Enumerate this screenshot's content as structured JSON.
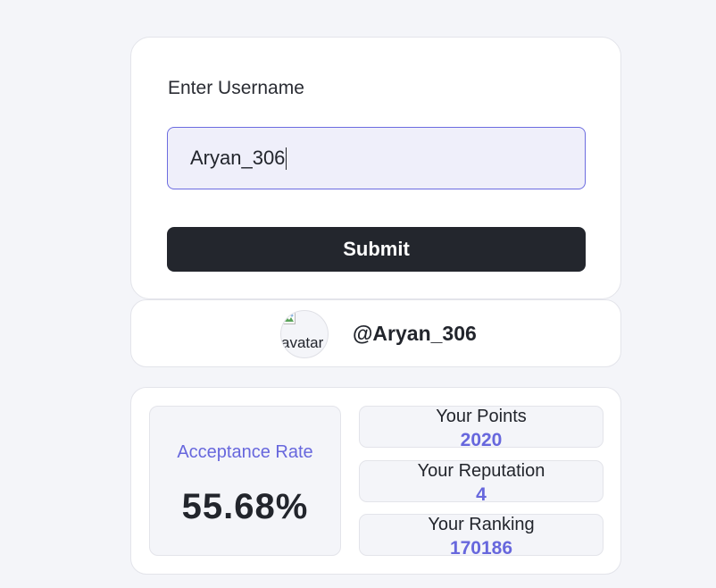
{
  "form": {
    "label": "Enter Username",
    "username_value": "Aryan_306",
    "submit_label": "Submit"
  },
  "profile": {
    "avatar_alt": "avatar",
    "handle": "@Aryan_306"
  },
  "stats": {
    "acceptance_label": "Acceptance Rate",
    "acceptance_value": "55.68%",
    "items": [
      {
        "title": "Your Points",
        "value": "2020"
      },
      {
        "title": "Your Reputation",
        "value": "4"
      },
      {
        "title": "Your Ranking",
        "value": "170186"
      }
    ]
  },
  "colors": {
    "accent": "#6767dd",
    "dark": "#23262d",
    "background": "#f4f5f9"
  }
}
